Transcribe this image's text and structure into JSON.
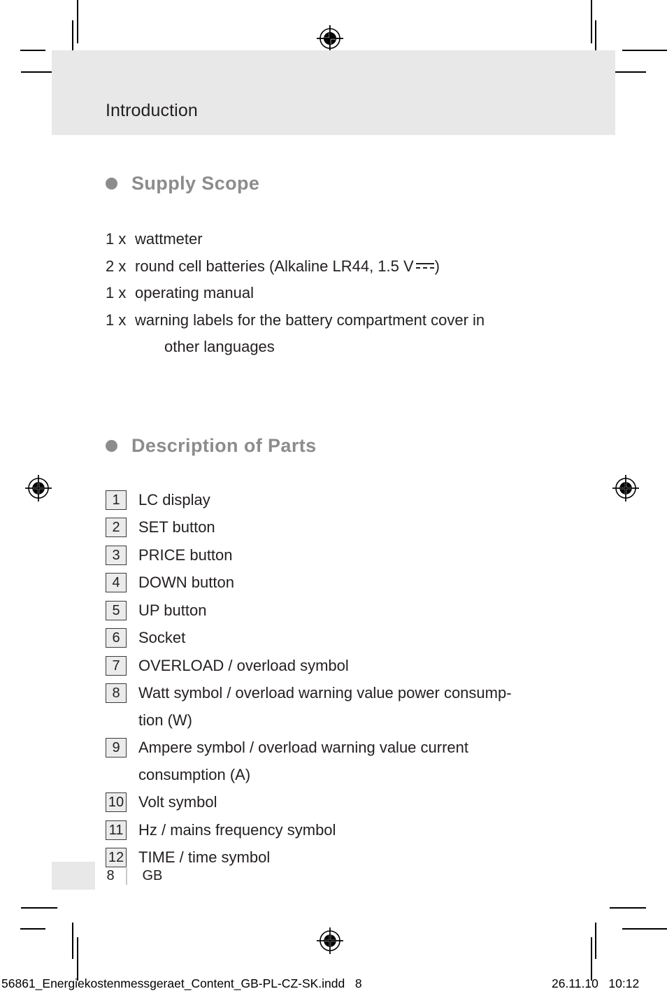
{
  "header": {
    "title": "Introduction"
  },
  "sections": [
    {
      "heading": "Supply Scope",
      "items": [
        {
          "qty": "1 x",
          "text": "wattmeter"
        },
        {
          "qty": "2 x",
          "text": "round cell batteries (Alkaline LR44, 1.5 V",
          "suffix": ")",
          "symbol": "dc-voltage-symbol"
        },
        {
          "qty": "1 x",
          "text": "operating manual"
        },
        {
          "qty": "1 x",
          "text": "warning labels for the battery compartment cover in",
          "cont": "other languages"
        }
      ]
    },
    {
      "heading": "Description of Parts",
      "parts": [
        {
          "num": "1",
          "label": "LC display"
        },
        {
          "num": "2",
          "label": "SET button"
        },
        {
          "num": "3",
          "label": "PRICE button"
        },
        {
          "num": "4",
          "label": "DOWN button"
        },
        {
          "num": "5",
          "label": "UP button"
        },
        {
          "num": "6",
          "label": "Socket"
        },
        {
          "num": "7",
          "label": "OVERLOAD / overload symbol"
        },
        {
          "num": "8",
          "label": "Watt symbol / overload warning value power consump-",
          "cont": "tion (W)"
        },
        {
          "num": "9",
          "label": "Ampere symbol / overload warning value current",
          "cont": "consumption (A)"
        },
        {
          "num": "10",
          "label": "Volt symbol"
        },
        {
          "num": "11",
          "label": "Hz / mains frequency symbol"
        },
        {
          "num": "12",
          "label": "TIME / time symbol"
        }
      ]
    }
  ],
  "footer": {
    "page_number": "8",
    "language": "GB"
  },
  "imprint": {
    "file": "56861_Energiekostenmessgeraet_Content_GB-PL-CZ-SK.indd   8",
    "date_time": "26.11.10   10:12"
  },
  "colors": {
    "band": "#e8e8e8",
    "heading": "#8c8c8c",
    "text": "#231f20",
    "box_fill": "#ebebeb",
    "box_border": "#3b3b3b"
  }
}
